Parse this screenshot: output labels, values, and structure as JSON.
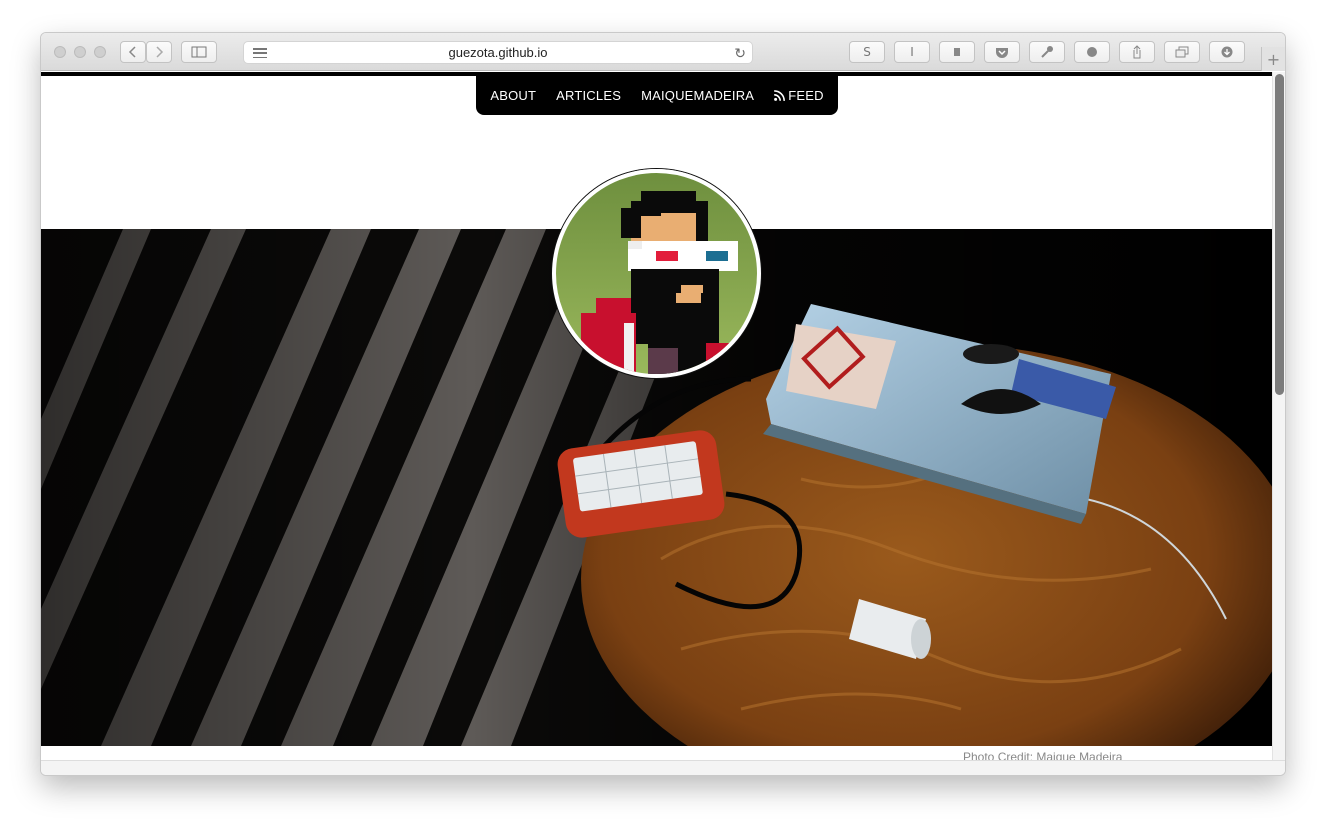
{
  "browser": {
    "url": "guezota.github.io",
    "toolbar_icons": [
      "sidebar-icon",
      "s-extension-icon",
      "i-extension-icon",
      "evernote-icon",
      "pocket-icon",
      "key-icon",
      "ghostery-icon",
      "share-icon",
      "tabs-icon",
      "download-icon"
    ],
    "extension_labels": {
      "s": "S",
      "i": "I"
    },
    "new_tab_label": "+"
  },
  "nav": {
    "items": [
      {
        "label": "ABOUT"
      },
      {
        "label": "ARTICLES"
      },
      {
        "label": "MAIQUEMADEIRA"
      },
      {
        "label": "FEED",
        "icon": "rss-icon"
      }
    ]
  },
  "hero": {
    "photo_credit": "Photo Credit: Maique Madeira"
  },
  "colors": {
    "nav_background": "#000000",
    "avatar_background": "#7fa24a",
    "table_wood": "#8a4c17",
    "drive_case": "#c2381e"
  }
}
